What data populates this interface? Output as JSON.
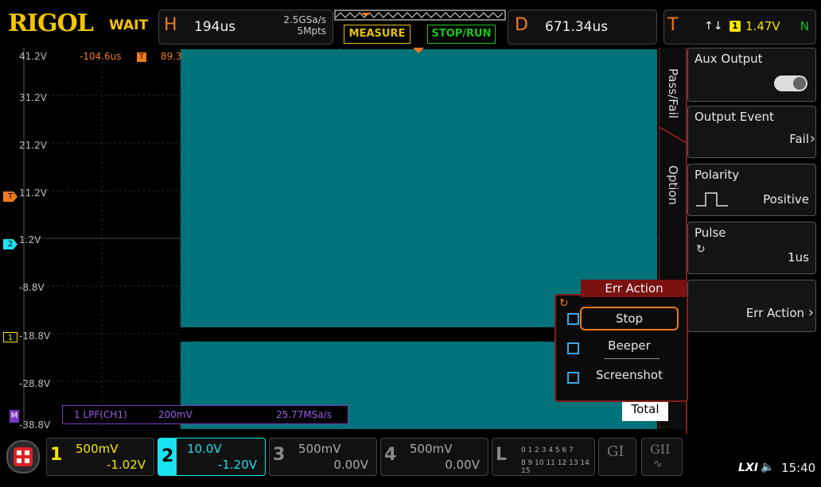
{
  "brand": "RIGOL",
  "status": "WAIT",
  "horizontal": {
    "letter": "H",
    "value": "194us",
    "sample_rate": "2.5GSa/s",
    "memory_depth": "5Mpts"
  },
  "buttons": {
    "measure": "MEASURE",
    "stop_run": "STOP/RUN"
  },
  "delay": {
    "letter": "D",
    "value": "671.34us"
  },
  "trigger": {
    "letter": "T",
    "arrows": "↑↓",
    "source": "1",
    "level": "1.47V",
    "mode": "N"
  },
  "cursor": {
    "time": "-104.6us",
    "partial": "89.3"
  },
  "volt_labels": [
    "41.2V",
    "31.2V",
    "21.2V",
    "11.2V",
    "1.2V",
    "-8.8V",
    "-18.8V",
    "-28.8V",
    "-38.8V"
  ],
  "markers": {
    "trigger": "T",
    "ch2": "2",
    "ch1": "1",
    "math": "M"
  },
  "side_tabs": [
    "Pass/Fail",
    "Option"
  ],
  "panels": {
    "aux_output": {
      "title": "Aux Output"
    },
    "output_event": {
      "title": "Output Event",
      "value": "Fail"
    },
    "polarity": {
      "title": "Polarity",
      "value": "Positive"
    },
    "pulse": {
      "title": "Pulse",
      "value": "1us"
    },
    "err_action": {
      "title": "Err Action"
    }
  },
  "popup": {
    "title": "Err Action",
    "options": [
      "Stop",
      "Beeper",
      "Screenshot"
    ],
    "total_label": "Total"
  },
  "lpf": {
    "label": "1  LPF(CH1)",
    "scale": "200mV",
    "rate": "25.77MSa/s"
  },
  "channels": [
    {
      "num": "1",
      "scale": "500mV",
      "offset": "-1.02V",
      "color": "#f5e400"
    },
    {
      "num": "2",
      "scale": "10.0V",
      "offset": "-1.20V",
      "color": "#19e3f0"
    },
    {
      "num": "3",
      "scale": "500mV",
      "offset": "0.00V",
      "color": "#888"
    },
    {
      "num": "4",
      "scale": "500mV",
      "offset": "0.00V",
      "color": "#888"
    }
  ],
  "logic": {
    "letter": "L",
    "row1": "0 1 2 3  4 5 6 7",
    "row2": "8 9 10 11 12 13 14 15"
  },
  "gi": [
    "GI",
    "GII"
  ],
  "lxi": "LXI",
  "time": "15:40",
  "colors": {
    "accent": "#f07a1c",
    "wave": "#00737a",
    "ch2": "#19e3f0",
    "menu_red": "#7a1212"
  }
}
